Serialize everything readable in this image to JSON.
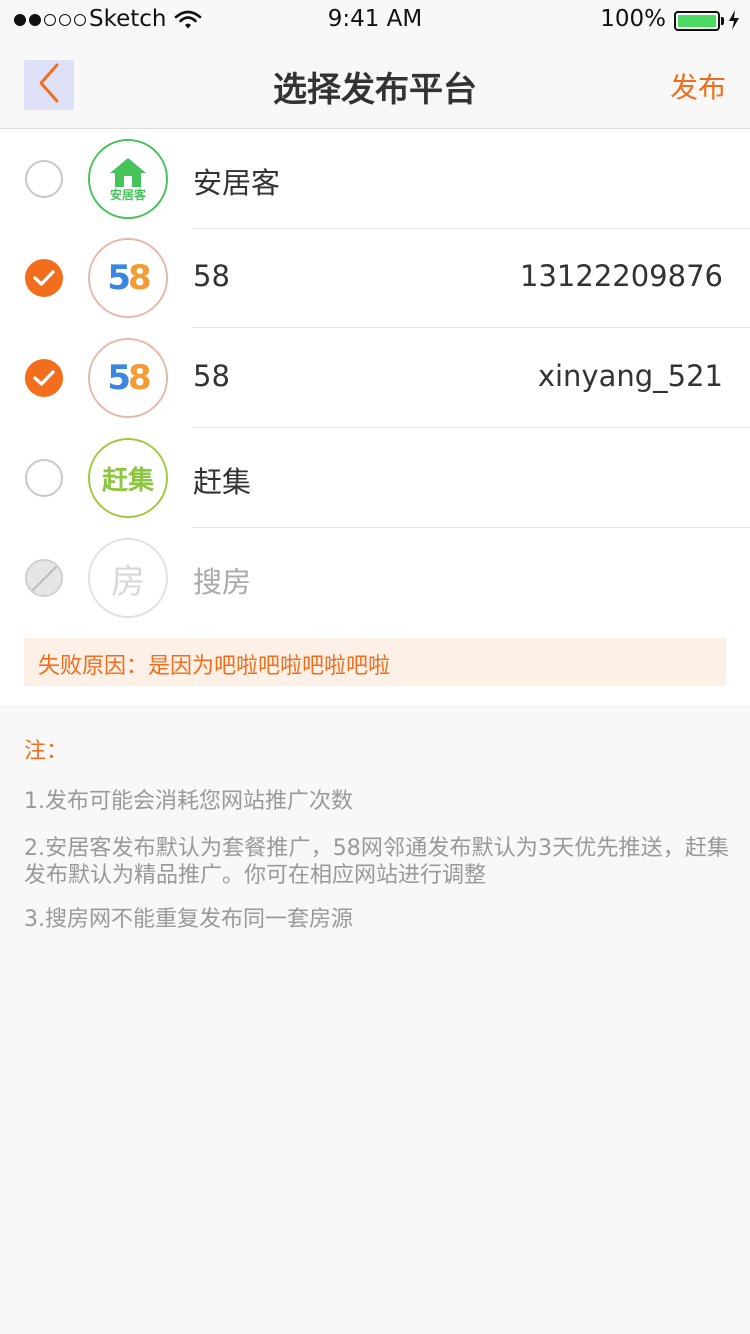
{
  "status_bar": {
    "carrier": "Sketch",
    "time": "9:41 AM",
    "battery": "100%"
  },
  "nav": {
    "title": "选择发布平台",
    "publish_label": "发布"
  },
  "platforms": [
    {
      "name": "安居客",
      "account": "",
      "state": "unchecked",
      "logo": "anjuke-house-icon",
      "logo_text": "安居客"
    },
    {
      "name": "58",
      "account": "13122209876",
      "state": "checked",
      "logo": "58-logo"
    },
    {
      "name": "58",
      "account": "xinyang_521",
      "state": "checked",
      "logo": "58-logo"
    },
    {
      "name": "赶集",
      "account": "",
      "state": "unchecked",
      "logo": "ganji-logo",
      "logo_text": "赶集"
    },
    {
      "name": "搜房",
      "account": "",
      "state": "disabled",
      "logo": "soufang-logo",
      "logo_text": "房"
    }
  ],
  "logo_58": {
    "five": "5",
    "eight": "8"
  },
  "failure": "失败原因：是因为吧啦吧啦吧啦吧啦",
  "notes": {
    "title": "注：",
    "items": [
      "1.发布可能会消耗您网站推广次数",
      "2.安居客发布默认为套餐推广，58网邻通发布默认为3天优先推送，赶集发布默认为精品推广。你可在相应网站进行调整",
      "3.搜房网不能重复发布同一套房源"
    ]
  },
  "colors": {
    "accent": "#f26d1c",
    "anjuke_green": "#46c35a",
    "ganji_green": "#8cc63f",
    "battery_green": "#4cd964"
  }
}
